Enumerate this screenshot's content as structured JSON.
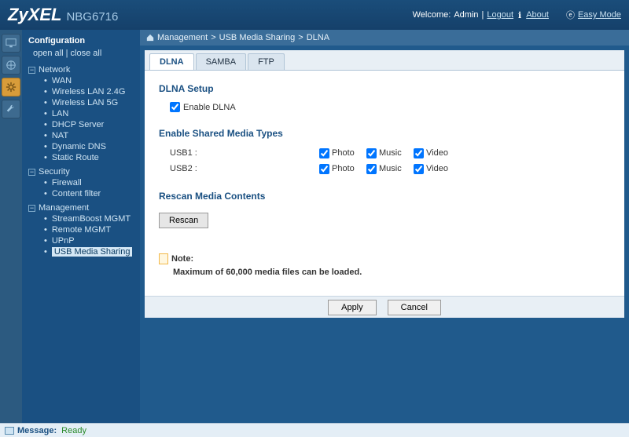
{
  "header": {
    "brand": "ZyXEL",
    "model": "NBG6716",
    "welcome_prefix": "Welcome:",
    "user": "Admin",
    "sep": "|",
    "logout": "Logout",
    "about": "About",
    "mode_glyph": "ⓔ",
    "easy_mode": "Easy Mode"
  },
  "sidebar": {
    "title": "Configuration",
    "open_all": "open all",
    "close_all": "close all",
    "sep": "|",
    "groups": [
      {
        "label": "Network",
        "items": [
          "WAN",
          "Wireless LAN 2.4G",
          "Wireless LAN 5G",
          "LAN",
          "DHCP Server",
          "NAT",
          "Dynamic DNS",
          "Static Route"
        ]
      },
      {
        "label": "Security",
        "items": [
          "Firewall",
          "Content filter"
        ]
      },
      {
        "label": "Management",
        "items": [
          "StreamBoost MGMT",
          "Remote MGMT",
          "UPnP",
          "USB Media Sharing"
        ]
      }
    ]
  },
  "breadcrumb": {
    "g1": "Management",
    "g2": "USB Media Sharing",
    "g3": "DLNA",
    "sep": ">"
  },
  "tabs": {
    "t0": "DLNA",
    "t1": "SAMBA",
    "t2": "FTP"
  },
  "dlna": {
    "setup_title": "DLNA Setup",
    "enable_label": "Enable DLNA",
    "media_title": "Enable Shared Media Types",
    "usb1": "USB1 :",
    "usb2": "USB2 :",
    "photo": "Photo",
    "music": "Music",
    "video": "Video",
    "rescan_title": "Rescan Media Contents",
    "rescan_btn": "Rescan",
    "note_label": "Note:",
    "note_text": "Maximum of 60,000 media files can be loaded."
  },
  "footer": {
    "apply": "Apply",
    "cancel": "Cancel"
  },
  "status": {
    "label": "Message:",
    "value": "Ready"
  }
}
